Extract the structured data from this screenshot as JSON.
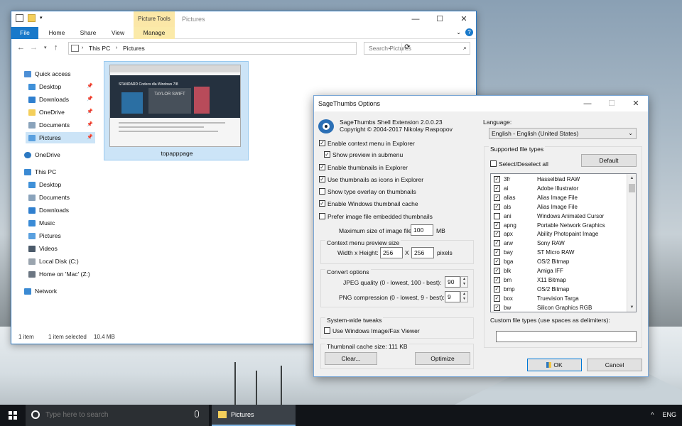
{
  "explorer": {
    "title": "Pictures",
    "contextual_tab": "Picture Tools",
    "tabs": [
      "File",
      "Home",
      "Share",
      "View",
      "Manage"
    ],
    "breadcrumb": [
      "This PC",
      "Pictures"
    ],
    "search_placeholder": "Search Pictures",
    "nav": {
      "quick_access": "Quick access",
      "quick_items": [
        "Desktop",
        "Downloads",
        "OneDrive",
        "Documents",
        "Pictures"
      ],
      "onedrive": "OneDrive",
      "this_pc": "This PC",
      "pc_items": [
        "Desktop",
        "Documents",
        "Downloads",
        "Music",
        "Pictures",
        "Videos",
        "Local Disk (C:)",
        "Home on 'Mac' (Z:)"
      ],
      "network": "Network"
    },
    "file": {
      "name": "topapppage",
      "thumb_headline": "STANDARD Codecs dla Windows 7/8",
      "thumb_caption": "TAYLOR SWIFT"
    },
    "status": {
      "count": "1 item",
      "selected": "1 item selected",
      "size": "10.4 MB"
    }
  },
  "dialog": {
    "title": "SageThumbs Options",
    "product": "SageThumbs Shell Extension 2.0.0.23",
    "copyright": "Copyright © 2004-2017 Nikolay Raspopov",
    "options": {
      "context_menu": "Enable context menu in Explorer",
      "preview_submenu": "Show preview in submenu",
      "thumbs_explorer": "Enable thumbnails in Explorer",
      "thumbs_icons": "Use thumbnails as icons in Explorer",
      "type_overlay": "Show type overlay on thumbnails",
      "windows_cache": "Enable Windows thumbnail cache",
      "prefer_embedded": "Prefer image file embedded thumbnails"
    },
    "max_size_label": "Maximum size of image file:",
    "max_size_value": "100",
    "max_size_unit": "MB",
    "preview_group": "Context menu preview size",
    "wh_label": "Width x Height:",
    "width": "256",
    "x_sep": "X",
    "height": "256",
    "pixels": "pixels",
    "convert_group": "Convert options",
    "jpeg_label": "JPEG quality (0 - lowest, 100 - best):",
    "jpeg_value": "90",
    "png_label": "PNG compression (0 - lowest, 9 - best):",
    "png_value": "9",
    "tweaks_group": "System-wide tweaks",
    "fax_viewer": "Use Windows Image/Fax Viewer",
    "cache_label": "Thumbnail cache size: 111 KB",
    "clear_btn": "Clear...",
    "optimize_btn": "Optimize",
    "language_label": "Language:",
    "language_value": "English - English (United States)",
    "supported_group": "Supported file types",
    "select_all": "Select/Deselect all",
    "default_btn": "Default",
    "file_types": [
      {
        "ext": "3fr",
        "desc": "Hasselblad RAW",
        "checked": true
      },
      {
        "ext": "ai",
        "desc": "Adobe Illustrator",
        "checked": true
      },
      {
        "ext": "alias",
        "desc": "Alias Image File",
        "checked": true
      },
      {
        "ext": "als",
        "desc": "Alias Image File",
        "checked": true
      },
      {
        "ext": "ani",
        "desc": "Windows Animated Cursor",
        "checked": false
      },
      {
        "ext": "apng",
        "desc": "Portable Network Graphics",
        "checked": true
      },
      {
        "ext": "apx",
        "desc": "Ability Photopaint Image",
        "checked": true
      },
      {
        "ext": "arw",
        "desc": "Sony RAW",
        "checked": true
      },
      {
        "ext": "bay",
        "desc": "ST Micro RAW",
        "checked": true
      },
      {
        "ext": "bga",
        "desc": "OS/2 Bitmap",
        "checked": true
      },
      {
        "ext": "blk",
        "desc": "Amiga IFF",
        "checked": true
      },
      {
        "ext": "bm",
        "desc": "X11 Bitmap",
        "checked": true
      },
      {
        "ext": "bmp",
        "desc": "OS/2 Bitmap",
        "checked": true
      },
      {
        "ext": "box",
        "desc": "Truevision Targa",
        "checked": true
      },
      {
        "ext": "bw",
        "desc": "Silicon Graphics RGB",
        "checked": true
      }
    ],
    "custom_label": "Custom file types (use spaces as delimiters):",
    "custom_value": "",
    "ok_btn": "OK",
    "cancel_btn": "Cancel"
  },
  "taskbar": {
    "search_placeholder": "Type here to search",
    "task": "Pictures",
    "tray_lang": "ENG",
    "tray_chevron": "^"
  }
}
